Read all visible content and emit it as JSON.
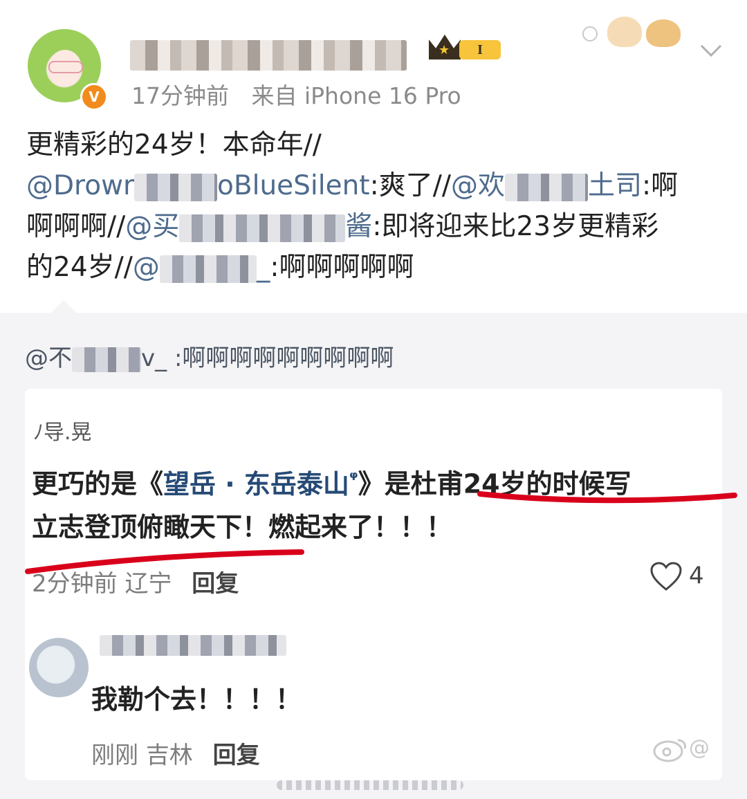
{
  "post": {
    "author_name": "",
    "time": "17分钟前",
    "source": "来自 iPhone 16 Pro",
    "vip_level": "I",
    "verified_mark": "V",
    "line1": "更精彩的24岁！本命年//",
    "mention1_visible": "@Drowr",
    "mention1_suffix": "oBlueSilent",
    "text2": ":爽了//",
    "mention2_visible": "@欢",
    "mention2_suffix": "土司",
    "text3": ":啊",
    "text4": "啊啊啊//",
    "mention3_visible": "@买",
    "mention3_suffix": "酱",
    "text5": ":即将迎来比23岁更精彩",
    "text6": "的24岁//",
    "mention4_visible": "@",
    "mention4_suffix": "_",
    "text7": ":啊啊啊啊啊"
  },
  "repost": {
    "quote_prefix": "@不",
    "quote_suffix": "v_",
    "quote_text": ":啊啊啊啊啊啊啊啊啊"
  },
  "comment": {
    "user_fragment": "ﾉ导.晃",
    "text_a": "更巧的是《",
    "link_text": "望岳 · 东岳泰山",
    "link_icon": "ᵠ",
    "text_b": "》是杜甫24岁的时候写",
    "line2": "立志登顶俯瞰天下！燃起来了！！！",
    "time": "2分钟前",
    "location": "辽宁",
    "reply_label": "回复",
    "likes": "4"
  },
  "sub_comment": {
    "text": "我勒个去！！！！",
    "time": "刚刚",
    "location": "吉林",
    "reply_label": "回复"
  },
  "watermark": "@",
  "colors": {
    "mention": "#4e6b8c",
    "link": "#264a76",
    "underline": "#d9001b",
    "verify": "#f28b1d",
    "panel_bg": "#f4f4f6"
  },
  "icons": [
    "verified-icon",
    "crown-icon",
    "chevron-down-icon",
    "heart-icon",
    "weibo-logo-icon"
  ]
}
